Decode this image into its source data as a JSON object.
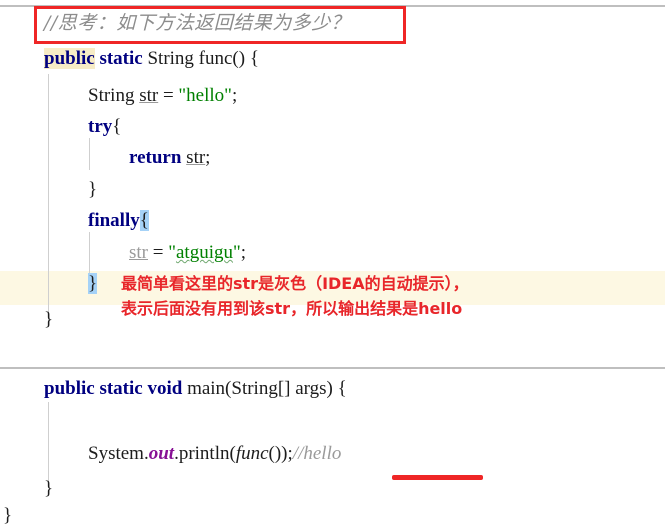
{
  "editor": {
    "app": "IDEA Java editor snippet",
    "rules": [
      "top-separator",
      "middle-separator"
    ],
    "caret_line_color": "#fdf8e3",
    "keyword_color": "#000080",
    "string_color": "#008000",
    "comment_color": "#9a9a9a",
    "field_color": "#871094",
    "identifier_highlight_tan": "#f7ecc6",
    "identifier_highlight_blue": "#a5d2f7",
    "annotation_red": "#e8262a"
  },
  "comment": {
    "text": "//思考：如下方法返回结果为多少？"
  },
  "method_func": {
    "lines": {
      "signature_kw": "public",
      "signature_static": " static ",
      "signature_rest": "String func() {",
      "decl_type": "String ",
      "decl_name": "str",
      "decl_assign": " = ",
      "decl_value": "\"hello\"",
      "decl_end": ";",
      "try_kw": "try",
      "try_brace": "{",
      "return_kw": "return ",
      "return_var": "str",
      "return_end": ";",
      "close_try": "}",
      "finally_kw": "finally",
      "finally_brace": "{",
      "assign_var": "str",
      "assign_op": " = ",
      "assign_value_open": "\"",
      "assign_value": "atguigu",
      "assign_value_close": "\"",
      "assign_end": ";",
      "close_finally": "}",
      "close_method": "}"
    }
  },
  "annotation": {
    "line1": "最简单看这里的str是灰色（IDEA的自动提示），",
    "line2": "表示后面没有用到该str，所以输出结果是hello"
  },
  "method_main": {
    "lines": {
      "signature_kw": "public static void ",
      "signature_rest": "main(String[] args) {",
      "print_obj": "System.",
      "print_field": "out",
      "print_dot": ".",
      "print_method": "println(",
      "print_call": "func",
      "print_args": "());",
      "print_comment": "//hello",
      "close_method": "}",
      "close_class": "}"
    }
  }
}
